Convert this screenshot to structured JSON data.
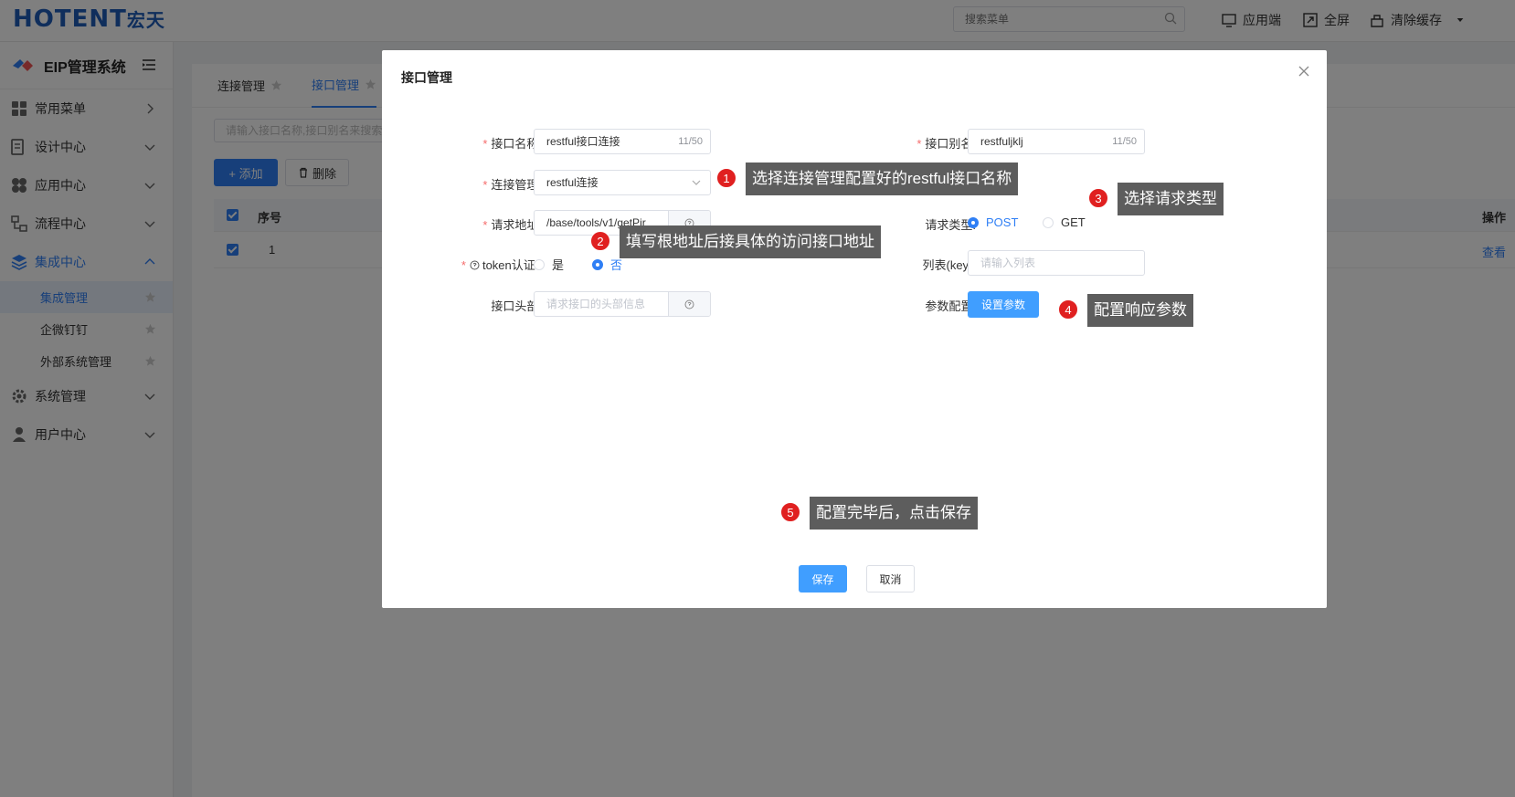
{
  "header": {
    "logo": "HOTENT",
    "logo_cn": "宏天",
    "search_placeholder": "搜索菜单",
    "actions": [
      "应用端",
      "全屏",
      "清除缓存"
    ]
  },
  "sidebar": {
    "title": "EIP管理系统",
    "items": [
      {
        "label": "常用菜单",
        "icon": "grid-icon"
      },
      {
        "label": "设计中心",
        "icon": "design-icon"
      },
      {
        "label": "应用中心",
        "icon": "apps-icon"
      },
      {
        "label": "流程中心",
        "icon": "flow-icon"
      },
      {
        "label": "集成中心",
        "icon": "layers-icon"
      },
      {
        "label": "系统管理",
        "icon": "gear-icon"
      },
      {
        "label": "用户中心",
        "icon": "user-icon"
      }
    ],
    "sub_items": [
      "集成管理",
      "企微钉钉",
      "外部系统管理"
    ]
  },
  "main": {
    "tabs": [
      "连接管理",
      "接口管理"
    ],
    "search_placeholder": "请输入接口名称,接口别名来搜索",
    "add_label": "+ 添加",
    "delete_label": "删除",
    "table": {
      "headers": [
        "序号",
        "操作"
      ],
      "rows": [
        {
          "index": "1",
          "action": "查看"
        }
      ]
    }
  },
  "dialog": {
    "title": "接口管理",
    "fields": {
      "name_label": "接口名称:",
      "name_value": "restful接口连接",
      "name_count": "11/50",
      "alias_label": "接口别名:",
      "alias_value": "restfuljklj",
      "alias_count": "11/50",
      "conn_label": "连接管理:",
      "conn_value": "restful连接",
      "url_label": "请求地址:",
      "url_value": "/base/tools/v1/getPir",
      "method_label": "请求类型:",
      "method_options": [
        "POST",
        "GET"
      ],
      "method_selected": "POST",
      "token_label": "token认证 :",
      "token_options": [
        "是",
        "否"
      ],
      "token_selected": "否",
      "list_label": "列表(key):",
      "list_placeholder": "请输入列表",
      "header_label": "接口头部:",
      "header_placeholder": "请求接口的头部信息",
      "param_label": "参数配置:",
      "param_button": "设置参数"
    },
    "save_label": "保存",
    "cancel_label": "取消"
  },
  "callouts": [
    {
      "num": "1",
      "text": "选择连接管理配置好的restful接口名称"
    },
    {
      "num": "2",
      "text": "填写根地址后接具体的访问接口地址"
    },
    {
      "num": "3",
      "text": "选择请求类型"
    },
    {
      "num": "4",
      "text": "配置响应参数"
    },
    {
      "num": "5",
      "text": "配置完毕后，点击保存"
    }
  ],
  "colors": {
    "primary": "#2f7ff5",
    "callout_bg": "#5d5d5d",
    "badge": "#e02020"
  }
}
